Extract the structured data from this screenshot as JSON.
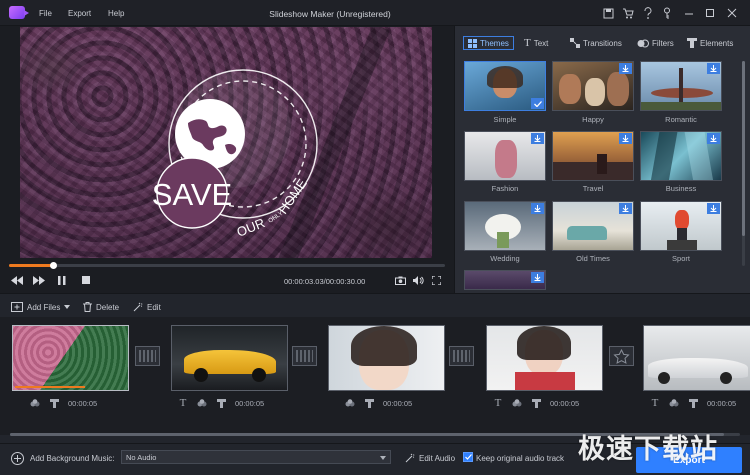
{
  "app": {
    "title": "Slideshow Maker (Unregistered)",
    "menu": [
      "File",
      "Export",
      "Help"
    ]
  },
  "colors": {
    "accent": "#2f80ff",
    "progress": "#ee7a1f",
    "tab_active": "#3d7ee0"
  },
  "preview": {
    "overlay_text": {
      "save": "SAVE",
      "our": "OUR",
      "only": "ONLY",
      "home": "HOME"
    },
    "timecode": "00:00:03.03/00:00:30.00",
    "progress_fraction": 0.1
  },
  "tabs": [
    "Themes",
    "Text",
    "Transitions",
    "Filters",
    "Elements"
  ],
  "themes": [
    "Simple",
    "Happy",
    "Romantic",
    "Fashion",
    "Travel",
    "Business",
    "Wedding",
    "Old Times",
    "Sport"
  ],
  "edit_toolbar": {
    "add_files": "Add Files",
    "delete": "Delete",
    "edit": "Edit"
  },
  "clips": [
    "00:00:05",
    "00:00:05",
    "00:00:05",
    "00:00:05",
    "00:00:05"
  ],
  "bottom": {
    "add_music": "Add Background Music:",
    "audio_value": "No Audio",
    "edit_audio": "Edit Audio",
    "keep_audio": "Keep original audio track",
    "keep_audio_checked": true,
    "export": "Export"
  },
  "watermark": "极速下载站"
}
